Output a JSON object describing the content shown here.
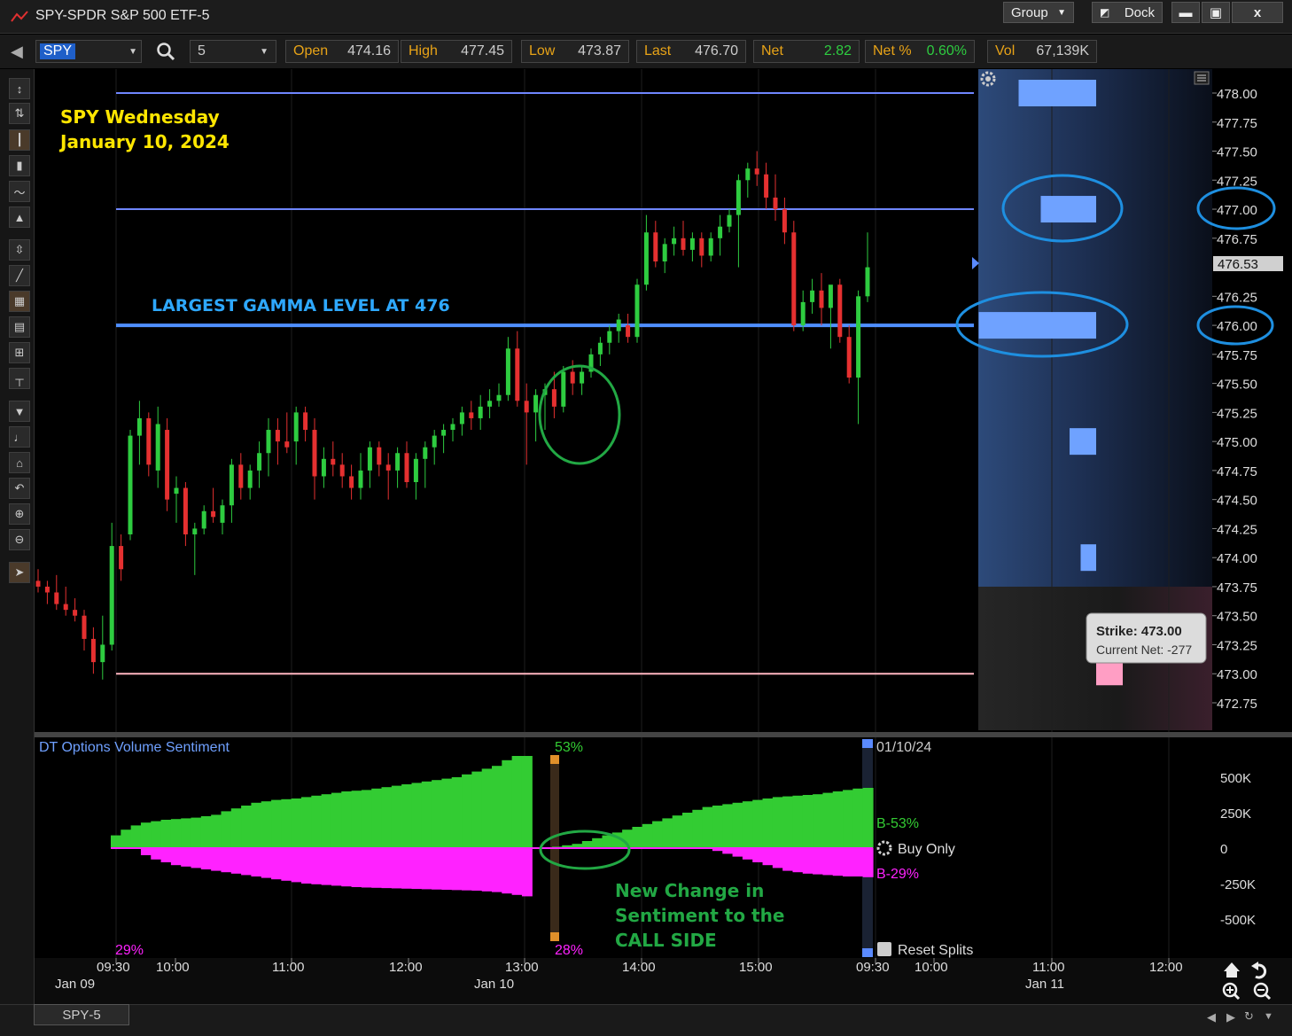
{
  "window": {
    "title": "SPY-SPDR S&P 500 ETF-5",
    "group_label": "Group",
    "dock_label": "Dock",
    "min_icon": "minimize-icon",
    "max_icon": "maximize-icon",
    "close_label": "x"
  },
  "toolbar": {
    "symbol": "SPY",
    "interval": "5",
    "quotes": [
      {
        "key": "Open",
        "value": "474.16"
      },
      {
        "key": "High",
        "value": "477.45"
      },
      {
        "key": "Low",
        "value": "473.87"
      },
      {
        "key": "Last",
        "value": "476.70"
      },
      {
        "key": "Net",
        "value": "2.82"
      },
      {
        "key": "Net %",
        "value": "0.60%"
      },
      {
        "key": "Vol",
        "value": "67,139K"
      }
    ]
  },
  "annotations": {
    "date_line1": "SPY Wednesday",
    "date_line2": "January 10, 2024",
    "gamma_label": "LARGEST GAMMA LEVEL AT 476",
    "sentiment_line1": "New Change in",
    "sentiment_line2": "Sentiment to the",
    "sentiment_line3": "CALL SIDE"
  },
  "tooltip": {
    "strike": "Strike: 473.00",
    "net": "Current Net: -277"
  },
  "sentiment_panel": {
    "title": "DT Options Volume Sentiment",
    "date": "01/10/24",
    "top_pct": "53%",
    "bottom_pct": "28%",
    "left_pct": "29%",
    "buy_label": "B-53%",
    "sell_label": "B-29%",
    "buy_only": "Buy Only",
    "reset_splits": "Reset Splits"
  },
  "chart_data": [
    {
      "type": "candlestick",
      "title": "",
      "ylim": [
        472.6,
        478.2
      ],
      "y_ticks": [
        "478.00",
        "477.75",
        "477.50",
        "477.25",
        "477.00",
        "476.75",
        "476.25",
        "476.00",
        "475.75",
        "475.50",
        "475.25",
        "475.00",
        "474.75",
        "474.50",
        "474.25",
        "474.00",
        "473.75",
        "473.50",
        "473.25",
        "473.00",
        "472.75"
      ],
      "current_price": "476.53",
      "time_ticks": [
        "09:30",
        "10:00",
        "11:00",
        "12:00",
        "13:00",
        "14:00",
        "15:00",
        "09:30",
        "10:00",
        "11:00",
        "12:00"
      ],
      "date_ticks": [
        "Jan 09",
        "Jan 10",
        "Jan 11"
      ],
      "horizontal_levels": [
        {
          "price": 478.0,
          "color": "#6f86ff"
        },
        {
          "price": 477.0,
          "color": "#6f86ff"
        },
        {
          "price": 476.0,
          "color": "#4f8fff"
        },
        {
          "price": 473.0,
          "color": "#ffb6c1"
        }
      ],
      "gamma_bars": [
        {
          "strike": 478.0,
          "value": 0.35
        },
        {
          "strike": 477.0,
          "value": 0.25
        },
        {
          "strike": 476.0,
          "value": 0.53
        },
        {
          "strike": 475.0,
          "value": 0.12
        },
        {
          "strike": 474.0,
          "value": 0.07
        },
        {
          "strike": 473.0,
          "value": -0.12
        }
      ],
      "candles_ohlc": [
        [
          473.8,
          473.9,
          473.7,
          473.75
        ],
        [
          473.75,
          473.8,
          473.6,
          473.7
        ],
        [
          473.7,
          473.85,
          473.55,
          473.6
        ],
        [
          473.6,
          473.75,
          473.5,
          473.55
        ],
        [
          473.55,
          473.65,
          473.45,
          473.5
        ],
        [
          473.5,
          473.55,
          473.2,
          473.3
        ],
        [
          473.3,
          473.4,
          473.0,
          473.1
        ],
        [
          473.1,
          473.5,
          472.95,
          473.25
        ],
        [
          473.25,
          474.3,
          473.2,
          474.1
        ],
        [
          474.1,
          474.2,
          473.8,
          473.9
        ],
        [
          474.2,
          475.1,
          474.15,
          475.05
        ],
        [
          475.05,
          475.35,
          474.8,
          475.2
        ],
        [
          475.2,
          475.25,
          474.7,
          474.8
        ],
        [
          474.75,
          475.3,
          474.6,
          475.15
        ],
        [
          475.1,
          475.2,
          474.4,
          474.5
        ],
        [
          474.55,
          474.7,
          474.3,
          474.6
        ],
        [
          474.6,
          474.65,
          474.1,
          474.2
        ],
        [
          474.2,
          474.3,
          473.85,
          474.25
        ],
        [
          474.25,
          474.45,
          474.2,
          474.4
        ],
        [
          474.4,
          474.6,
          474.3,
          474.35
        ],
        [
          474.3,
          474.5,
          474.2,
          474.45
        ],
        [
          474.45,
          474.85,
          474.3,
          474.8
        ],
        [
          474.8,
          474.9,
          474.5,
          474.6
        ],
        [
          474.6,
          474.8,
          474.5,
          474.75
        ],
        [
          474.75,
          475.0,
          474.6,
          474.9
        ],
        [
          474.9,
          475.2,
          474.7,
          475.1
        ],
        [
          475.1,
          475.2,
          474.8,
          475.0
        ],
        [
          475.0,
          475.25,
          474.9,
          474.95
        ],
        [
          475.0,
          475.3,
          474.8,
          475.25
        ],
        [
          475.25,
          475.3,
          475.0,
          475.1
        ],
        [
          475.1,
          475.2,
          474.5,
          474.7
        ],
        [
          474.7,
          474.95,
          474.6,
          474.85
        ],
        [
          474.85,
          475.0,
          474.7,
          474.8
        ],
        [
          474.8,
          474.9,
          474.6,
          474.7
        ],
        [
          474.7,
          474.8,
          474.5,
          474.6
        ],
        [
          474.6,
          474.9,
          474.5,
          474.75
        ],
        [
          474.75,
          475.0,
          474.6,
          474.95
        ],
        [
          474.95,
          475.0,
          474.7,
          474.8
        ],
        [
          474.8,
          474.9,
          474.5,
          474.75
        ],
        [
          474.75,
          474.95,
          474.6,
          474.9
        ],
        [
          474.9,
          475.0,
          474.6,
          474.65
        ],
        [
          474.65,
          474.9,
          474.5,
          474.85
        ],
        [
          474.85,
          475.0,
          474.6,
          474.95
        ],
        [
          474.95,
          475.1,
          474.8,
          475.05
        ],
        [
          475.05,
          475.15,
          474.9,
          475.1
        ],
        [
          475.1,
          475.2,
          475.0,
          475.15
        ],
        [
          475.15,
          475.3,
          475.05,
          475.25
        ],
        [
          475.25,
          475.35,
          475.1,
          475.2
        ],
        [
          475.2,
          475.4,
          475.1,
          475.3
        ],
        [
          475.3,
          475.45,
          475.2,
          475.35
        ],
        [
          475.35,
          475.5,
          475.3,
          475.4
        ],
        [
          475.4,
          475.9,
          475.35,
          475.8
        ],
        [
          475.8,
          475.95,
          475.3,
          475.35
        ],
        [
          475.35,
          475.5,
          474.8,
          475.25
        ],
        [
          475.25,
          475.45,
          475.0,
          475.4
        ],
        [
          475.4,
          475.5,
          475.1,
          475.45
        ],
        [
          475.45,
          475.6,
          475.2,
          475.3
        ],
        [
          475.3,
          475.65,
          475.25,
          475.6
        ],
        [
          475.6,
          475.7,
          475.4,
          475.5
        ],
        [
          475.5,
          475.65,
          475.4,
          475.6
        ],
        [
          475.6,
          475.8,
          475.55,
          475.75
        ],
        [
          475.75,
          475.9,
          475.65,
          475.85
        ],
        [
          475.85,
          476.0,
          475.75,
          475.95
        ],
        [
          475.95,
          476.1,
          475.85,
          476.05
        ],
        [
          476.0,
          476.1,
          475.85,
          475.9
        ],
        [
          475.9,
          476.4,
          475.85,
          476.35
        ],
        [
          476.35,
          476.95,
          476.3,
          476.8
        ],
        [
          476.8,
          476.9,
          476.5,
          476.55
        ],
        [
          476.55,
          476.75,
          476.45,
          476.7
        ],
        [
          476.7,
          476.85,
          476.6,
          476.75
        ],
        [
          476.75,
          476.9,
          476.6,
          476.65
        ],
        [
          476.65,
          476.8,
          476.55,
          476.75
        ],
        [
          476.75,
          476.8,
          476.5,
          476.6
        ],
        [
          476.6,
          476.8,
          476.55,
          476.75
        ],
        [
          476.75,
          476.95,
          476.6,
          476.85
        ],
        [
          476.85,
          477.0,
          476.8,
          476.95
        ],
        [
          476.95,
          477.3,
          476.5,
          477.25
        ],
        [
          477.25,
          477.4,
          477.1,
          477.35
        ],
        [
          477.35,
          477.5,
          477.2,
          477.3
        ],
        [
          477.3,
          477.4,
          477.0,
          477.1
        ],
        [
          477.1,
          477.3,
          476.9,
          477.0
        ],
        [
          477.0,
          477.1,
          476.7,
          476.8
        ],
        [
          476.8,
          476.9,
          475.95,
          476.0
        ],
        [
          476.0,
          476.3,
          475.95,
          476.2
        ],
        [
          476.2,
          476.4,
          476.1,
          476.3
        ],
        [
          476.3,
          476.45,
          476.0,
          476.15
        ],
        [
          476.15,
          476.3,
          475.8,
          476.35
        ],
        [
          476.35,
          476.4,
          475.85,
          475.9
        ],
        [
          475.9,
          476.0,
          475.5,
          475.55
        ],
        [
          475.55,
          476.3,
          475.15,
          476.25
        ],
        [
          476.25,
          476.8,
          476.2,
          476.5
        ]
      ]
    },
    {
      "type": "area",
      "title": "DT Options Volume Sentiment",
      "ylim": [
        -750000,
        650000
      ],
      "y_ticks": [
        "500K",
        "250K",
        "0",
        "-250K",
        "-500K"
      ],
      "series": [
        {
          "name": "Buy",
          "values": [
            90000,
            130000,
            160000,
            180000,
            190000,
            200000,
            205000,
            210000,
            215000,
            225000,
            235000,
            260000,
            280000,
            300000,
            320000,
            330000,
            340000,
            345000,
            350000,
            360000,
            370000,
            380000,
            390000,
            400000,
            405000,
            410000,
            420000,
            430000,
            440000,
            450000,
            460000,
            470000,
            480000,
            490000,
            500000,
            520000,
            540000,
            560000,
            580000,
            620000,
            650000,
            650000,
            0,
            5000,
            10000,
            20000,
            30000,
            50000,
            70000,
            90000,
            110000,
            130000,
            150000,
            170000,
            190000,
            210000,
            230000,
            250000,
            270000,
            290000,
            300000,
            310000,
            320000,
            330000,
            340000,
            350000,
            360000,
            365000,
            370000,
            375000,
            380000,
            390000,
            400000,
            410000,
            420000,
            425000
          ]
        },
        {
          "name": "Sell",
          "values": [
            0,
            0,
            0,
            -50000,
            -80000,
            -100000,
            -120000,
            -130000,
            -140000,
            -150000,
            -160000,
            -170000,
            -180000,
            -190000,
            -200000,
            -210000,
            -220000,
            -230000,
            -240000,
            -250000,
            -255000,
            -260000,
            -265000,
            -270000,
            -275000,
            -278000,
            -280000,
            -282000,
            -284000,
            -286000,
            -288000,
            -290000,
            -292000,
            -294000,
            -296000,
            -298000,
            -300000,
            -305000,
            -310000,
            -320000,
            -330000,
            -340000,
            0,
            0,
            0,
            0,
            0,
            0,
            0,
            0,
            0,
            0,
            0,
            0,
            0,
            0,
            0,
            0,
            0,
            0,
            -20000,
            -40000,
            -60000,
            -80000,
            -100000,
            -120000,
            -140000,
            -160000,
            -170000,
            -180000,
            -185000,
            -190000,
            -195000,
            -200000,
            -200000,
            -205000
          ]
        }
      ]
    }
  ]
}
